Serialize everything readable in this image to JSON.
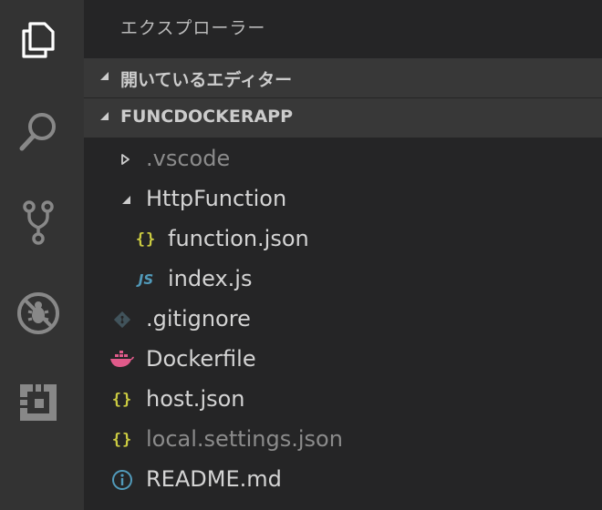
{
  "activity_bar": {
    "items": [
      {
        "name": "explorer",
        "icon": "files-icon",
        "active": true
      },
      {
        "name": "search",
        "icon": "search-icon",
        "active": false
      },
      {
        "name": "source-control",
        "icon": "source-control-icon",
        "active": false
      },
      {
        "name": "debug",
        "icon": "debug-icon",
        "active": false
      },
      {
        "name": "extensions",
        "icon": "extensions-icon",
        "active": false
      }
    ]
  },
  "explorer": {
    "title": "エクスプローラー",
    "open_editors_label": "開いているエディター",
    "project_label": "FUNCDOCKERAPP",
    "tree": [
      {
        "name": ".vscode",
        "type": "folder",
        "expanded": false,
        "dim": true
      },
      {
        "name": "HttpFunction",
        "type": "folder",
        "expanded": true,
        "dim": false
      },
      {
        "name": "function.json",
        "type": "file",
        "icon": "json-braces-icon",
        "dim": false
      },
      {
        "name": "index.js",
        "type": "file",
        "icon": "js-icon",
        "dim": false
      },
      {
        "name": ".gitignore",
        "type": "file",
        "icon": "git-icon",
        "dim": false
      },
      {
        "name": "Dockerfile",
        "type": "file",
        "icon": "docker-icon",
        "dim": false
      },
      {
        "name": "host.json",
        "type": "file",
        "icon": "json-braces-icon",
        "dim": false
      },
      {
        "name": "local.settings.json",
        "type": "file",
        "icon": "json-braces-icon",
        "dim": true
      },
      {
        "name": "README.md",
        "type": "file",
        "icon": "info-icon",
        "dim": false
      }
    ],
    "icon_glyphs": {
      "braces": "{}",
      "js": "JS"
    }
  },
  "colors": {
    "activity_bg": "#333333",
    "sidebar_bg": "#252526",
    "section_bg": "#383838",
    "json": "#cbcb41",
    "js": "#519aba",
    "docker": "#e05a8a",
    "git": "#41535b",
    "info": "#519aba"
  }
}
